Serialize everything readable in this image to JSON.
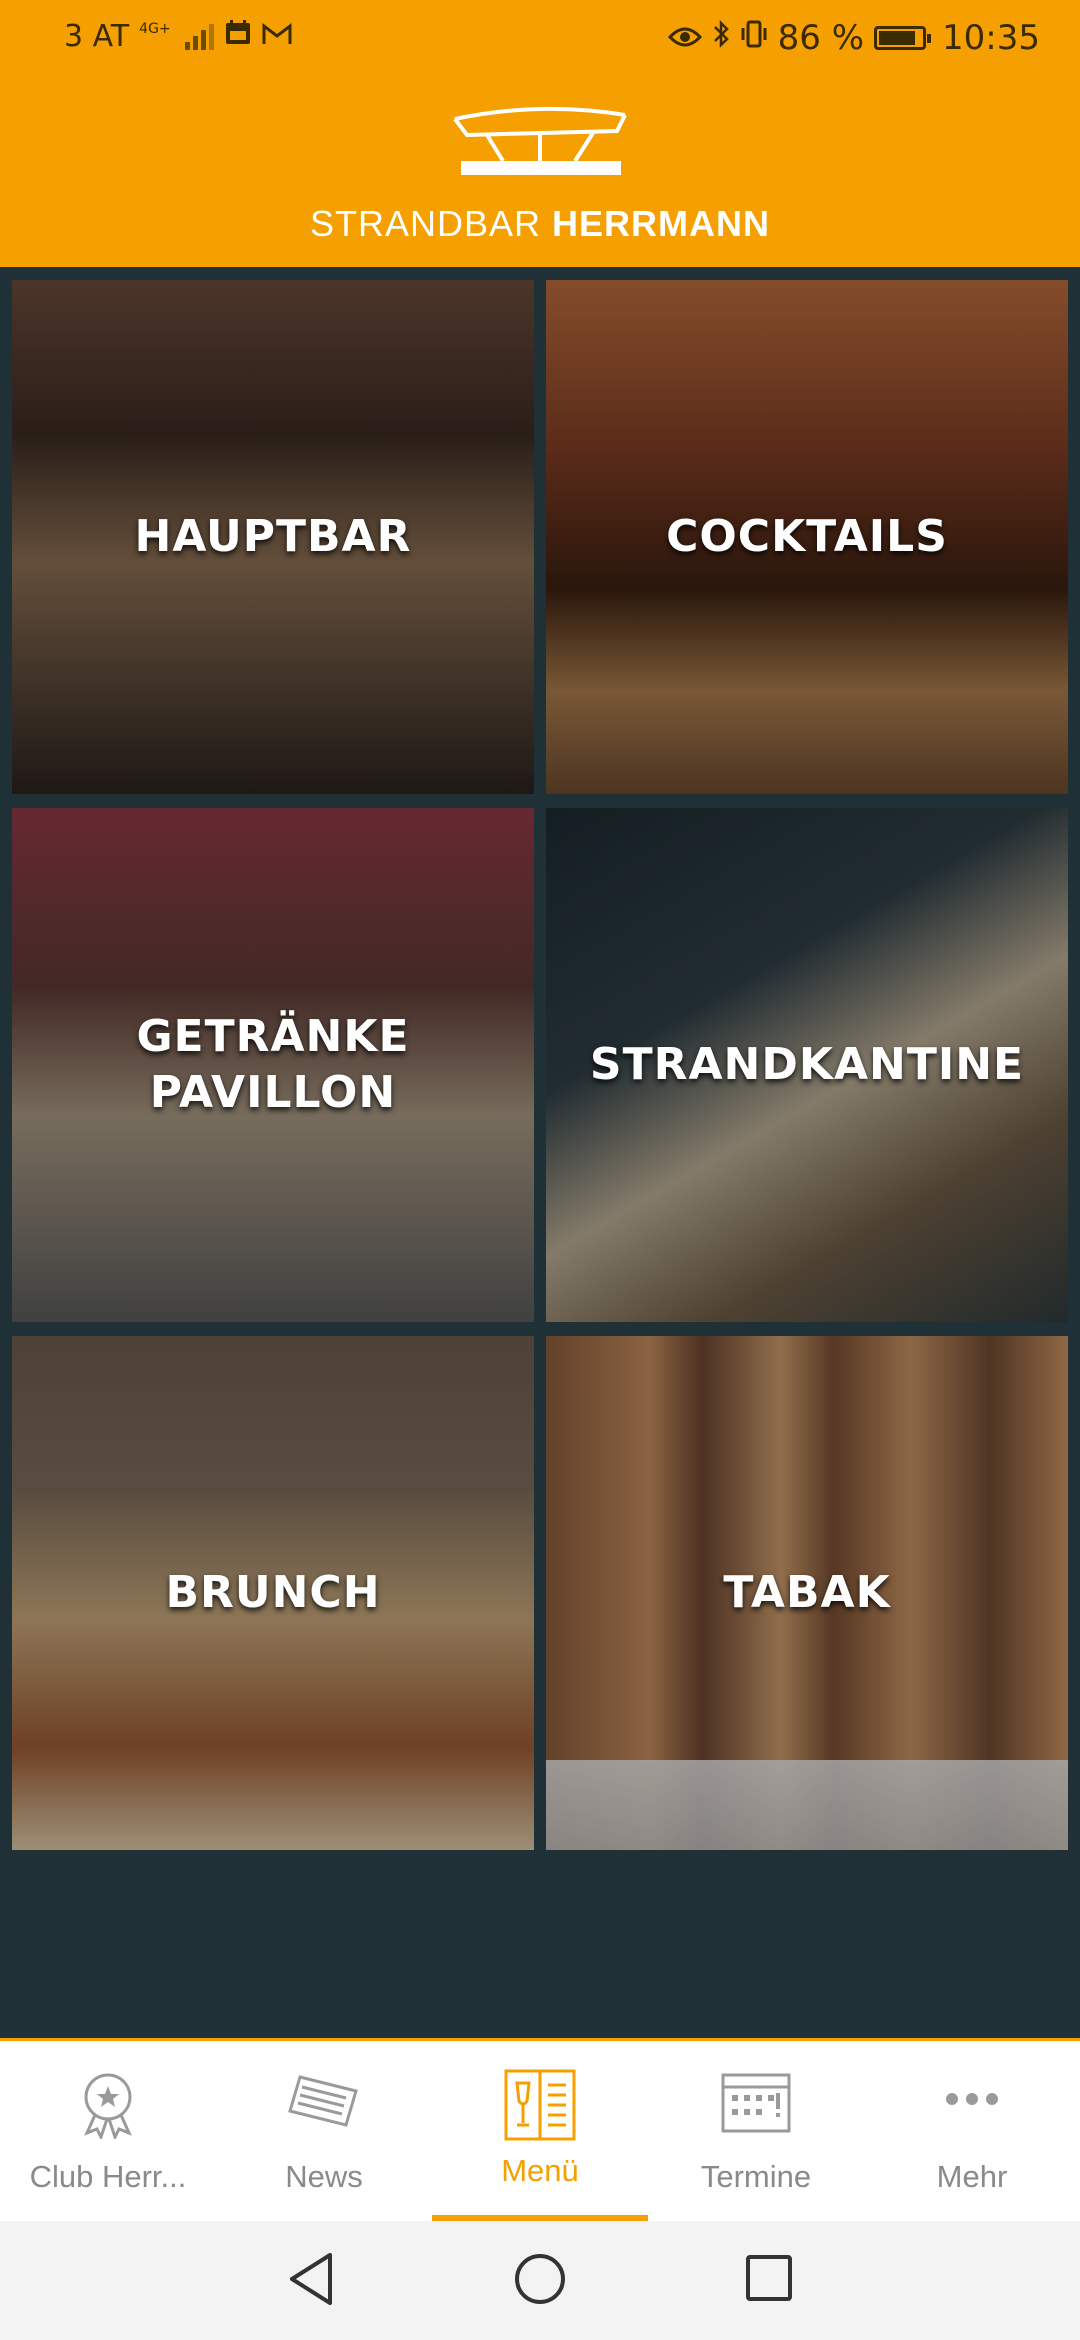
{
  "status_bar": {
    "carrier": "3 AT",
    "network": "4G+",
    "battery": "86 %",
    "battery_level": 0.86,
    "time": "10:35"
  },
  "header": {
    "brand_light": "STRANDBAR ",
    "brand_bold": "HERRMANN"
  },
  "tiles": [
    {
      "label": "HAUPTBAR"
    },
    {
      "label": "COCKTAILS"
    },
    {
      "label": "GETRÄNKE\nPAVILLON"
    },
    {
      "label": "STRANDKANTINE"
    },
    {
      "label": "BRUNCH"
    },
    {
      "label": "TABAK"
    }
  ],
  "bottom_nav": {
    "active": "Menü",
    "items": [
      {
        "label": "Club Herr...",
        "icon": "award-badge-icon"
      },
      {
        "label": "News",
        "icon": "newspaper-icon"
      },
      {
        "label": "Menü",
        "icon": "menu-card-icon"
      },
      {
        "label": "Termine",
        "icon": "calendar-icon"
      },
      {
        "label": "Mehr",
        "icon": "more-dots-icon"
      }
    ]
  },
  "colors": {
    "accent": "#f5a000",
    "background": "#1f3036",
    "nav_inactive": "#8a8a8a"
  }
}
